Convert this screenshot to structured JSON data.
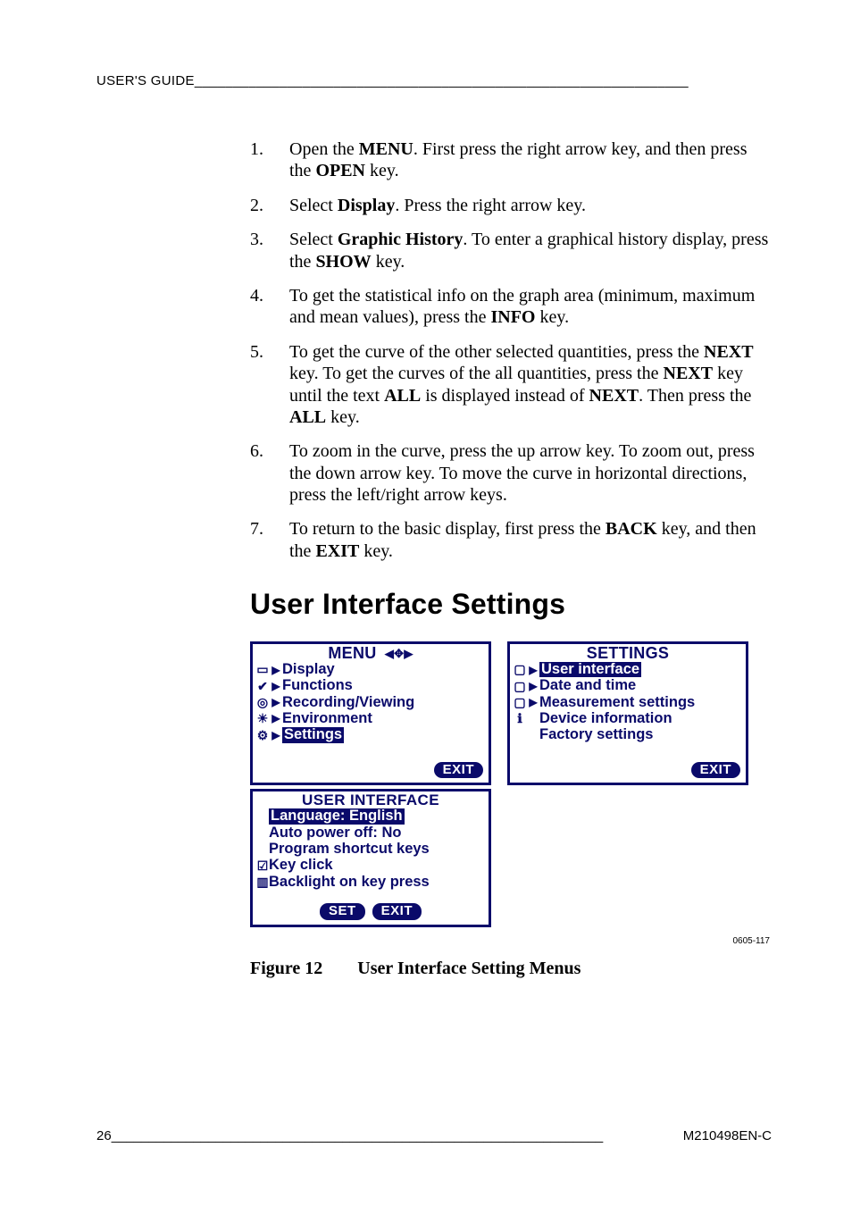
{
  "header": {
    "title": "USER'S GUIDE",
    "rule": "________________________________________________________________"
  },
  "steps": [
    {
      "num": "1.",
      "segments": [
        {
          "t": "Open the "
        },
        {
          "t": "MENU",
          "b": true
        },
        {
          "t": ". First press the right arrow key, and then press the "
        },
        {
          "t": "OPEN",
          "b": true
        },
        {
          "t": " key."
        }
      ]
    },
    {
      "num": "2.",
      "segments": [
        {
          "t": "Select "
        },
        {
          "t": "Display",
          "b": true
        },
        {
          "t": ". Press the right arrow key."
        }
      ]
    },
    {
      "num": "3.",
      "segments": [
        {
          "t": "Select "
        },
        {
          "t": "Graphic History",
          "b": true
        },
        {
          "t": ". To enter a graphical history display, press the "
        },
        {
          "t": "SHOW",
          "b": true
        },
        {
          "t": " key."
        }
      ]
    },
    {
      "num": "4.",
      "segments": [
        {
          "t": "To get the statistical info on the graph area (minimum, maximum and mean values), press the "
        },
        {
          "t": "INFO",
          "b": true
        },
        {
          "t": " key."
        }
      ]
    },
    {
      "num": "5.",
      "segments": [
        {
          "t": "To get the curve of the other selected quantities, press the "
        },
        {
          "t": "NEXT",
          "b": true
        },
        {
          "t": " key. To get the curves of the all quantities, press the "
        },
        {
          "t": "NEXT",
          "b": true
        },
        {
          "t": " key until the text "
        },
        {
          "t": "ALL",
          "b": true
        },
        {
          "t": " is displayed instead of "
        },
        {
          "t": "NEXT",
          "b": true
        },
        {
          "t": ". Then press the "
        },
        {
          "t": "ALL",
          "b": true
        },
        {
          "t": " key."
        }
      ]
    },
    {
      "num": "6.",
      "segments": [
        {
          "t": "To zoom in the curve, press the up arrow key. To zoom out, press the down arrow key. To move the curve in horizontal directions, press the left/right arrow keys."
        }
      ]
    },
    {
      "num": "7.",
      "segments": [
        {
          "t": "To return to the basic display, first press the "
        },
        {
          "t": "BACK",
          "b": true
        },
        {
          "t": " key, and then the "
        },
        {
          "t": "EXIT",
          "b": true
        },
        {
          "t": " key."
        }
      ]
    }
  ],
  "section_heading": "User Interface Settings",
  "screens": {
    "menu": {
      "title": "MENU",
      "nav_glyph": "◀✥▶",
      "items": [
        {
          "icon": "▭",
          "arrow": "▶",
          "label": "Display",
          "inverted": false
        },
        {
          "icon": "✔",
          "arrow": "▶",
          "label": "Functions",
          "inverted": false
        },
        {
          "icon": "◎",
          "arrow": "▶",
          "label": "Recording/Viewing",
          "inverted": false
        },
        {
          "icon": "☀",
          "arrow": "▶",
          "label": "Environment",
          "inverted": false
        },
        {
          "icon": "⚙",
          "arrow": "▶",
          "label": "Settings",
          "inverted": true
        }
      ],
      "softkeys": [
        "EXIT"
      ]
    },
    "settings": {
      "title": "SETTINGS",
      "items": [
        {
          "icon": "▢",
          "arrow": "▶",
          "label": "User interface",
          "inverted": true
        },
        {
          "icon": "▢",
          "arrow": "▶",
          "label": "Date and time",
          "inverted": false
        },
        {
          "icon": "▢",
          "arrow": "▶",
          "label": "Measurement settings",
          "inverted": false
        },
        {
          "icon": "ℹ",
          "arrow": "",
          "label": "Device information",
          "inverted": false
        },
        {
          "icon": "",
          "arrow": "",
          "label": "Factory settings",
          "inverted": false
        }
      ],
      "softkeys": [
        "EXIT"
      ]
    },
    "ui": {
      "title": "USER INTERFACE",
      "items": [
        {
          "icon": "",
          "arrow": "",
          "label": "Language: English",
          "inverted": true
        },
        {
          "icon": "",
          "arrow": "",
          "label": "Auto power off: No",
          "inverted": false
        },
        {
          "icon": "",
          "arrow": "",
          "label": "Program shortcut keys",
          "inverted": false
        },
        {
          "icon": "☑",
          "arrow": "",
          "label": "Key click",
          "inverted": false
        },
        {
          "icon": "▥",
          "arrow": "",
          "label": "Backlight on key press",
          "inverted": false
        }
      ],
      "softkeys": [
        "SET",
        "EXIT"
      ]
    }
  },
  "image_code": "0605-117",
  "figure": {
    "label": "Figure 12",
    "title": "User Interface Setting Menus"
  },
  "footer": {
    "page": "26",
    "rule": " __________________________________________________________________ ",
    "doc": "M210498EN-C"
  }
}
